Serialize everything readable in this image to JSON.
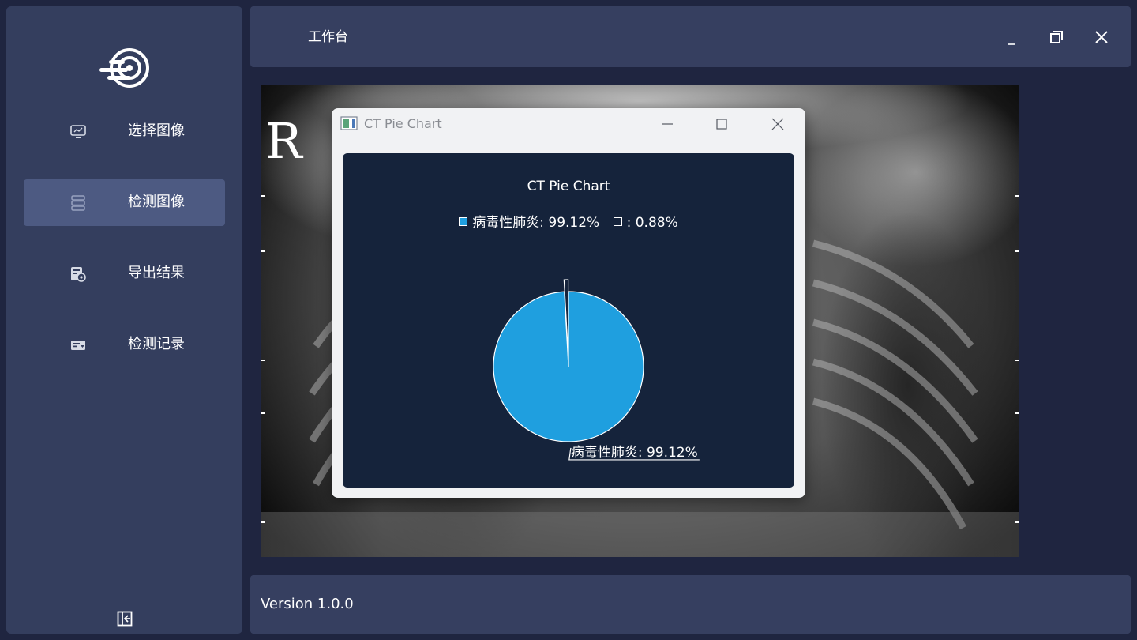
{
  "sidebar": {
    "items": [
      {
        "label": "选择图像",
        "icon": "monitor-chart-icon",
        "active": false
      },
      {
        "label": "检测图像",
        "icon": "database-stack-icon",
        "active": true
      },
      {
        "label": "导出结果",
        "icon": "export-settings-icon",
        "active": false
      },
      {
        "label": "检测记录",
        "icon": "record-list-icon",
        "active": false
      }
    ]
  },
  "header": {
    "title": "工作台"
  },
  "xray": {
    "marker": "R"
  },
  "dialog": {
    "window_title": "CT Pie Chart"
  },
  "chart_data": {
    "type": "pie",
    "title": "CT Pie Chart",
    "series": [
      {
        "name": "病毒性肺炎",
        "value": 99.12,
        "color": "#1f9fdf",
        "legend": "病毒性肺炎: 99.12%",
        "label": "病毒性肺炎: 99.12%"
      },
      {
        "name": "",
        "value": 0.88,
        "color": "#ffffff",
        "legend": ": 0.88%",
        "exploded": true
      }
    ],
    "legend_position": "top"
  },
  "footer": {
    "version": "Version 1.0.0"
  },
  "colors": {
    "background": "#1f2540",
    "panel": "#343e5e",
    "active": "#4d5a82",
    "chart_bg": "#15233b",
    "accent": "#1f9fdf"
  }
}
